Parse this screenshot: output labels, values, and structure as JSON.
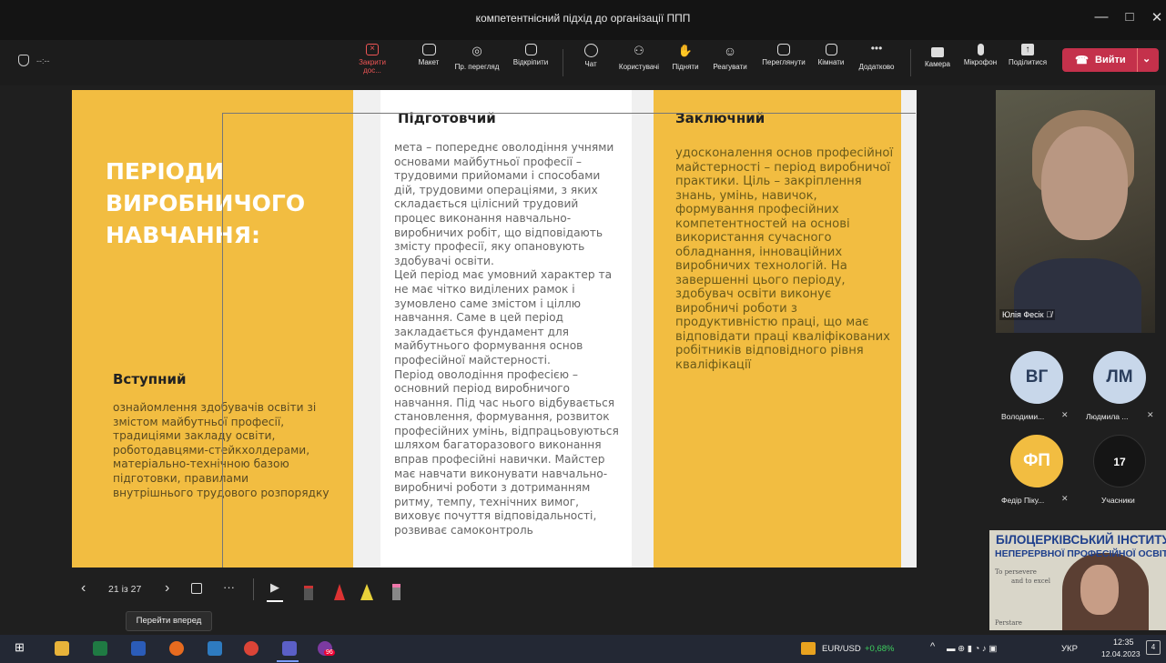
{
  "window": {
    "title": "компетентнісний підхід до організації ППП",
    "min": "—",
    "max": "□",
    "close": "✕"
  },
  "status": {
    "timer": "--:--"
  },
  "toolbar": {
    "stop_share": "Закрити дос...",
    "layout": "Макет",
    "presenter_view": "Пр. перегляд",
    "popout": "Відкріпити",
    "chat": "Чат",
    "people": "Користувачі",
    "raise": "Підняти",
    "react": "Реагувати",
    "view": "Переглянути",
    "rooms": "Кімнати",
    "more": "Додатково",
    "camera": "Камера",
    "mic": "Мікрофон",
    "share": "Поділитися",
    "leave": "Вийти"
  },
  "slide": {
    "heading_lines": [
      "ПЕРІОДИ",
      "ВИРОБНИЧОГО",
      "НАВЧАННЯ:"
    ],
    "col1_title": "Вступний",
    "col1_text": "ознайомлення здобувачів освіти зі змістом майбутньої професії,  традиціями закладу освіти, роботодавцями-стейкхолдерами, матеріально-технічною базою підготовки, правилами внутрішнього трудового розпорядку",
    "col2_title": "Підготовчий",
    "col2_text": "мета – попереднє оволодіння учнями основами майбутньої професії – трудовими прийомами і способами дій, трудовими операціями, з яких складається цілісний трудовий процес виконання навчально-виробничих робіт, що відповідають змісту професії, яку опановують здобувачі освіти.\nЦей період має умовний характер та не має чітко виділених рамок і зумовлено саме змістом і ціллю навчання. Саме в цей період закладається фундамент для майбутнього формування основ професійної майстерності.\nПеріод оволодіння професією – основний період виробничого навчання. Під час нього відбувається становлення, формування, розвиток професійних умінь, відпрацьовуються шляхом багаторазового виконання вправ професійні навички. Майстер має навчати виконувати навчально-виробничі роботи з дотриманням ритму, темпу, технічних вимог, виховує почуття відповідальності, розвиває самоконтроль",
    "col3_title": "Заключний",
    "col3_text": "удосконалення основ професійної майстерності – період виробничої практики. Ціль – закріплення знань, умінь, навичок, формування професійних компетентностей на основі використання сучасного обладнання, інноваційних виробничих технологій. На завершенні цього періоду, здобувач освіти виконує виробничі роботи з продуктивністю праці, що має відповідати праці кваліфікованих робітників відповідного рівня кваліфікації"
  },
  "slide_controls": {
    "counter": "21 із 27",
    "tooltip": "Перейти вперед"
  },
  "participants": {
    "video_name": "Юлія Фесік",
    "p1_initials": "ВГ",
    "p1_name": "Володими...",
    "p2_initials": "ЛМ",
    "p2_name": "Людмила ...",
    "p3_initials": "ФП",
    "p3_name": "Федір Піку...",
    "count": "17",
    "count_label": "Учасники"
  },
  "logo": {
    "line1": "БІЛОЦЕРКІВСЬКИЙ ІНСТИТУТ",
    "line2": "НЕПЕРЕРВНОЇ ПРОФЕСІЙНОЇ ОСВІТИ",
    "motto1": "To persevere",
    "motto2": "and to excel",
    "motto3": "Perstare"
  },
  "taskbar": {
    "ticker": "EUR/USD",
    "ticker_change": "+0,68%",
    "lang": "УКР",
    "time": "12:35",
    "date": "12.04.2023",
    "badge": "96",
    "notif": "4"
  },
  "colors": {
    "accent_yellow": "#f2bd41",
    "leave_red": "#c4314b",
    "ticker_green": "#3ecf5e"
  }
}
